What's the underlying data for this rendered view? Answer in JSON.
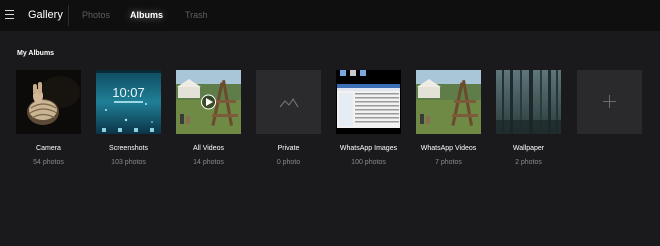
{
  "header": {
    "title": "Gallery",
    "tabs": [
      {
        "label": "Photos",
        "active": false
      },
      {
        "label": "Albums",
        "active": true
      },
      {
        "label": "Trash",
        "active": false
      }
    ]
  },
  "section_title": "My Albums",
  "albums": [
    {
      "name": "Camera",
      "count": "54 photos"
    },
    {
      "name": "Screenshots",
      "count": "103 photos",
      "lock_time": "10:07"
    },
    {
      "name": "All Videos",
      "count": "14 photos"
    },
    {
      "name": "Private",
      "count": "0 photo"
    },
    {
      "name": "WhatsApp Images",
      "count": "100 photos"
    },
    {
      "name": "WhatsApp Videos",
      "count": "7 photos"
    },
    {
      "name": "Wallpaper",
      "count": "2 photos"
    }
  ],
  "colors": {
    "background": "#1a1a1c",
    "topbar": "#0f0f10",
    "tile": "#2a2a2c",
    "text": "#ffffff",
    "muted": "#8a8a8e"
  }
}
